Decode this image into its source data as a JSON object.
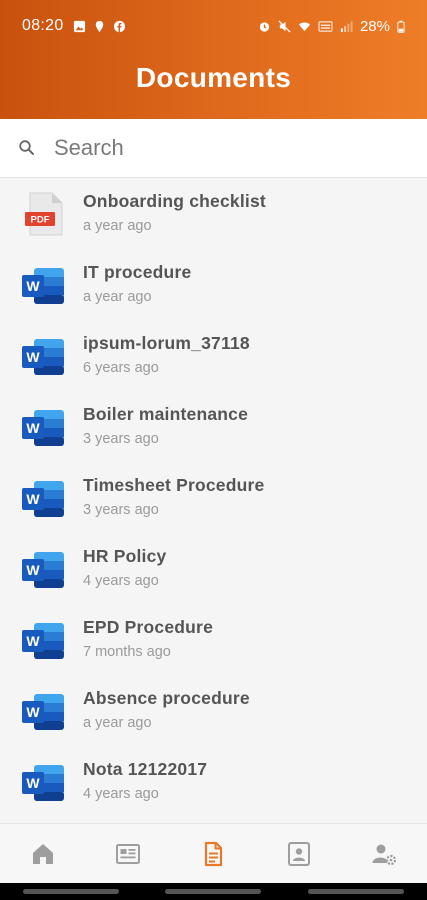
{
  "status_bar": {
    "time": "08:20",
    "battery": "28%",
    "left_icons": [
      "gallery-icon",
      "location-icon",
      "facebook-icon"
    ],
    "right_icons": [
      "alarm-icon",
      "mute-icon",
      "wifi-icon",
      "volte-icon",
      "signal-icon",
      "battery-icon"
    ]
  },
  "header": {
    "title": "Documents"
  },
  "search": {
    "placeholder": "Search",
    "icon": "search-icon"
  },
  "documents": [
    {
      "name": "Onboarding checklist",
      "date": "a year ago",
      "type": "pdf",
      "badge": "PDF"
    },
    {
      "name": "IT procedure",
      "date": "a year ago",
      "type": "word",
      "badge": "W"
    },
    {
      "name": "ipsum-lorum_37118",
      "date": "6 years ago",
      "type": "word",
      "badge": "W"
    },
    {
      "name": "Boiler maintenance",
      "date": "3 years ago",
      "type": "word",
      "badge": "W"
    },
    {
      "name": "Timesheet Procedure",
      "date": "3 years ago",
      "type": "word",
      "badge": "W"
    },
    {
      "name": "HR Policy",
      "date": "4 years ago",
      "type": "word",
      "badge": "W"
    },
    {
      "name": "EPD Procedure",
      "date": "7 months ago",
      "type": "word",
      "badge": "W"
    },
    {
      "name": "Absence procedure",
      "date": "a year ago",
      "type": "word",
      "badge": "W"
    },
    {
      "name": "Nota 12122017",
      "date": "4 years ago",
      "type": "word",
      "badge": "W"
    }
  ],
  "bottom_nav": [
    {
      "icon": "home-icon",
      "active": false
    },
    {
      "icon": "news-icon",
      "active": false
    },
    {
      "icon": "documents-icon",
      "active": true
    },
    {
      "icon": "contact-card-icon",
      "active": false
    },
    {
      "icon": "user-settings-icon",
      "active": false
    }
  ],
  "colors": {
    "header_start": "#c9510e",
    "header_end": "#ee7d28",
    "accent": "#e8782a",
    "inactive_icon": "#9e9e9e",
    "pdf_red": "#e2432e",
    "word_blue": "#185abd"
  }
}
